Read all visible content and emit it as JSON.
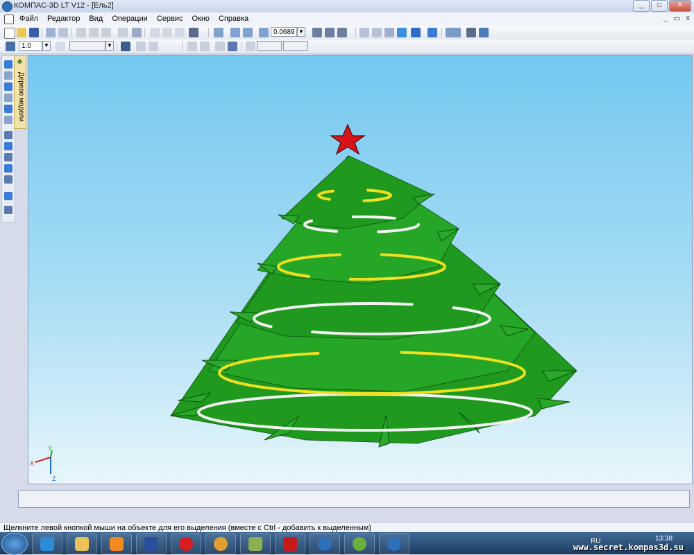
{
  "window": {
    "title": "КОМПАС-3D LT V12 - [Ель2]",
    "minimize": "_",
    "maximize": "□",
    "close": "✕"
  },
  "menu": {
    "items": [
      "Файл",
      "Редактор",
      "Вид",
      "Операции",
      "Сервис",
      "Окно",
      "Справка"
    ],
    "doc_minimize": "_",
    "doc_restore": "▭",
    "doc_close": "x"
  },
  "toolbar": {
    "zoom_value": "0.0689",
    "step_value": "1.0"
  },
  "tree_tab": {
    "label": "Дерево модели"
  },
  "axes": {
    "x": "X",
    "y": "Y",
    "z": "Z"
  },
  "status_bar": {
    "hint": "Щелкните левой кнопкой мыши на объекте для его выделения (вместе с Ctrl - добавить к выделенным)"
  },
  "taskbar": {
    "language": "RU",
    "time": "13:38",
    "watermark": "www.secret.kompas3d.su"
  },
  "colors": {
    "tree_green": "#1f9a1f",
    "garland_white": "#f2f2f2",
    "garland_yellow": "#f0e020",
    "star_red": "#d8141b",
    "sky_top": "#73c8ef"
  }
}
